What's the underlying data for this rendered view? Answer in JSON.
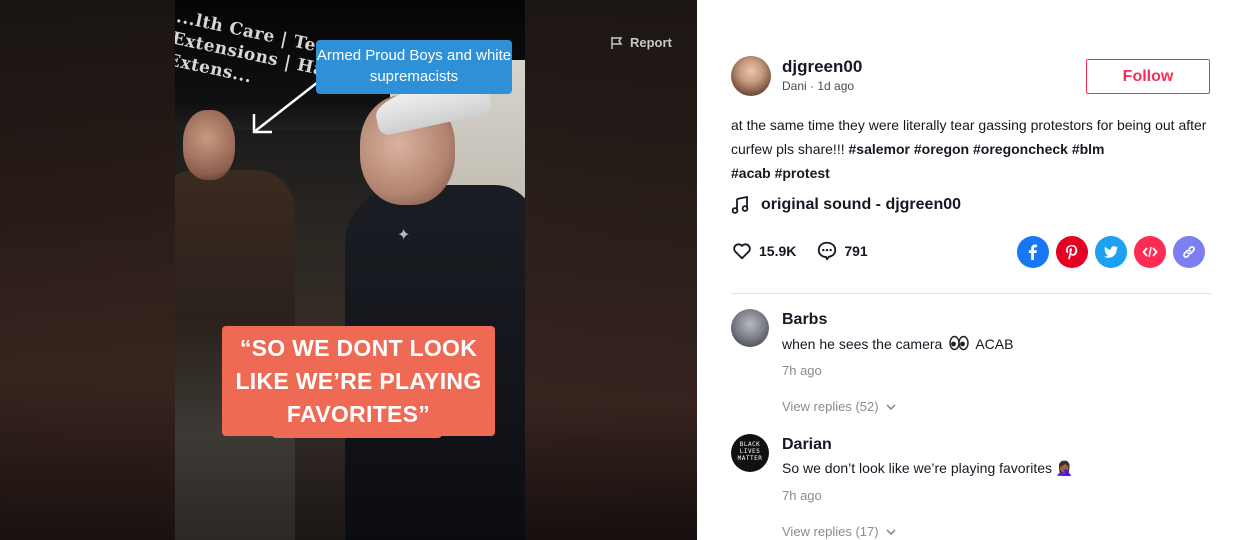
{
  "video": {
    "report_label": "Report",
    "storefront_text": "...lth Care | Teet... Extensions | Hair Extens...",
    "caption_top": "Armed Proud Boys and white supremacists",
    "caption_main": "“SO WE DONT LOOK LIKE WE’RE PLAYING FAVORITES”"
  },
  "post": {
    "username": "djgreen00",
    "meta": "Dani · 1d ago",
    "follow_label": "Follow",
    "description": "at the same time they were literally tear gassing protestors for being out after curfew pls share!!!",
    "hashtags": [
      "#salemor",
      "#oregon",
      "#oregoncheck",
      "#blm",
      "#acab",
      "#protest"
    ],
    "music": "original sound - djgreen00",
    "likes": "15.9K",
    "comments": "791"
  },
  "share": {
    "facebook_color": "#1877f2",
    "pinterest_color": "#e60023",
    "twitter_color": "#1da1f2",
    "embed_color": "#fe2c55",
    "link_color": "#7b7ff0"
  },
  "comments": [
    {
      "name": "Barbs",
      "text_before": "when he sees the camera",
      "text_after": "ACAB",
      "time": "7h ago",
      "replies": "View replies (52)"
    },
    {
      "name": "Darian",
      "avatar_text": "BLACK LIVES MATTER",
      "text": "So we don’t look like we’re playing favorites 🤦🏾‍♀️",
      "time": "7h ago",
      "replies": "View replies (17)"
    }
  ]
}
